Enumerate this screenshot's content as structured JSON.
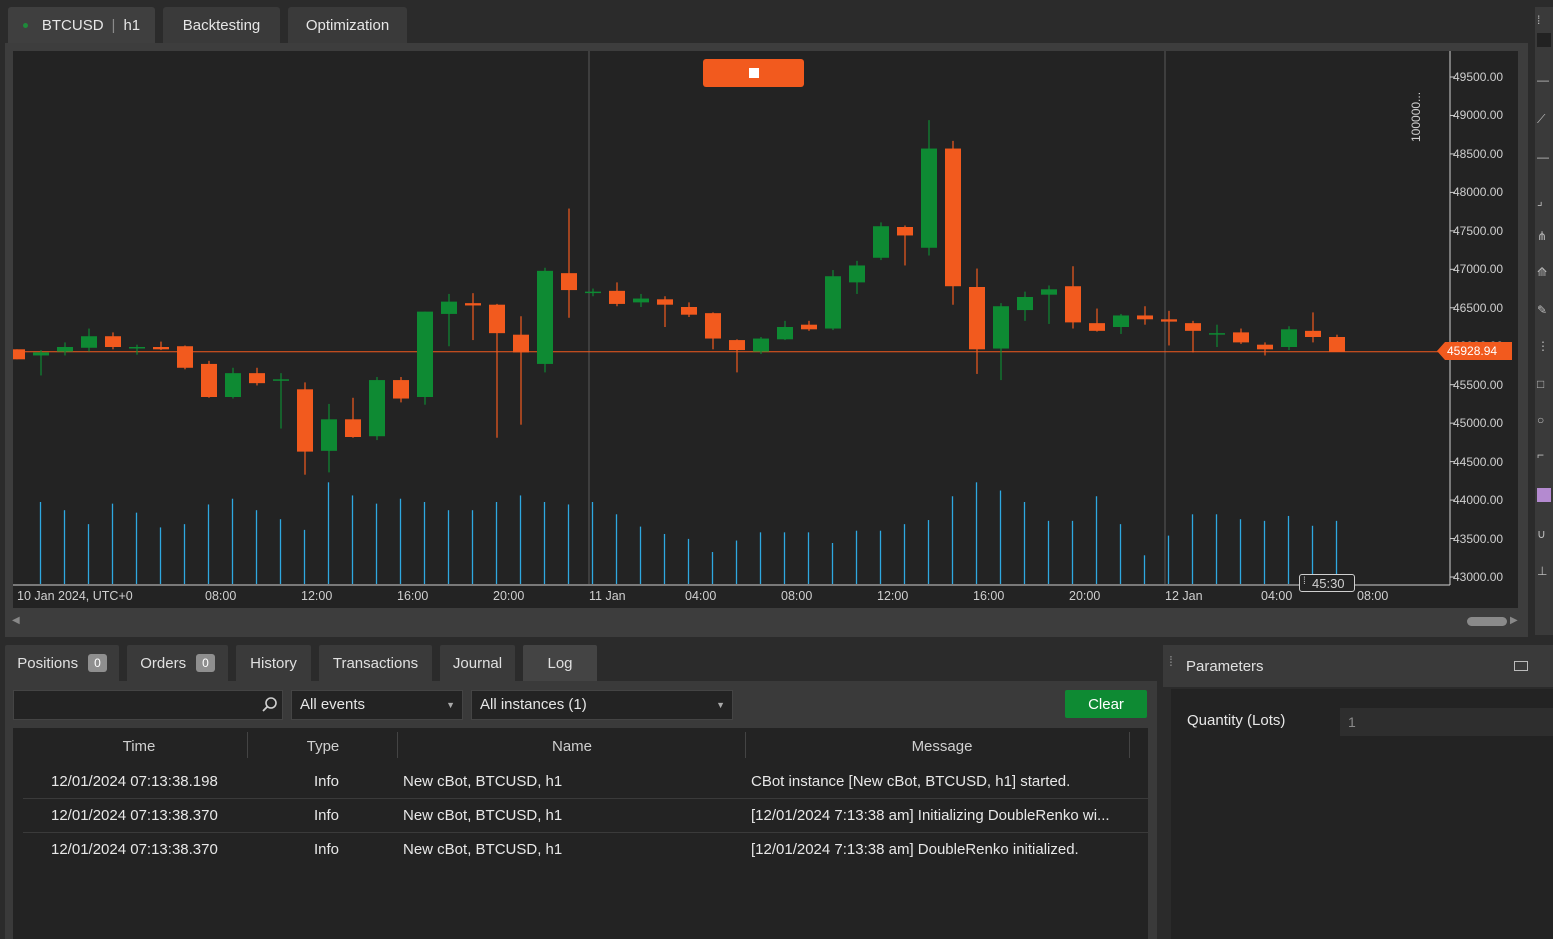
{
  "top_tabs": {
    "symbol": "BTCUSD",
    "timeframe": "h1",
    "backtesting": "Backtesting",
    "optimization": "Optimization"
  },
  "chart": {
    "price_axis": [
      "49500.00",
      "49000.00",
      "48500.00",
      "48000.00",
      "47500.00",
      "47000.00",
      "46500.00",
      "46000.00",
      "45500.00",
      "45000.00",
      "44500.00",
      "44000.00",
      "43500.00",
      "43000.00"
    ],
    "current_price": "45928.94",
    "time_axis": [
      "10 Jan 2024, UTC+0",
      "08:00",
      "12:00",
      "16:00",
      "20:00",
      "11 Jan",
      "04:00",
      "08:00",
      "12:00",
      "16:00",
      "20:00",
      "12 Jan",
      "04:00",
      "08:00"
    ],
    "countdown": "45:30",
    "volume_label": "100000...",
    "colors": {
      "bull": "#0e8a33",
      "bear": "#f25a1e",
      "volume": "#2ea8e0"
    }
  },
  "chart_data": {
    "type": "candlestick",
    "timeframe": "h1",
    "ylim": [
      43000,
      49600
    ],
    "candles": [
      {
        "o": 45960,
        "h": 45960,
        "l": 45830,
        "c": 45830
      },
      {
        "o": 45880,
        "h": 45950,
        "l": 45620,
        "c": 45920
      },
      {
        "o": 45930,
        "h": 46050,
        "l": 45880,
        "c": 45990
      },
      {
        "o": 45980,
        "h": 46230,
        "l": 45930,
        "c": 46130
      },
      {
        "o": 46130,
        "h": 46180,
        "l": 45960,
        "c": 45990
      },
      {
        "o": 45980,
        "h": 46020,
        "l": 45890,
        "c": 45990
      },
      {
        "o": 45990,
        "h": 46060,
        "l": 45950,
        "c": 45960
      },
      {
        "o": 46000,
        "h": 46010,
        "l": 45700,
        "c": 45720
      },
      {
        "o": 45770,
        "h": 45810,
        "l": 45330,
        "c": 45340
      },
      {
        "o": 45340,
        "h": 45720,
        "l": 45320,
        "c": 45650
      },
      {
        "o": 45650,
        "h": 45720,
        "l": 45490,
        "c": 45520
      },
      {
        "o": 45570,
        "h": 45650,
        "l": 44930,
        "c": 45570
      },
      {
        "o": 45440,
        "h": 45530,
        "l": 44330,
        "c": 44630
      },
      {
        "o": 44640,
        "h": 45250,
        "l": 44360,
        "c": 45050
      },
      {
        "o": 45050,
        "h": 45330,
        "l": 44810,
        "c": 44820
      },
      {
        "o": 44830,
        "h": 45600,
        "l": 44780,
        "c": 45560
      },
      {
        "o": 45560,
        "h": 45600,
        "l": 45270,
        "c": 45320
      },
      {
        "o": 45340,
        "h": 46450,
        "l": 45240,
        "c": 46450
      },
      {
        "o": 46420,
        "h": 46680,
        "l": 46000,
        "c": 46580
      },
      {
        "o": 46560,
        "h": 46690,
        "l": 46080,
        "c": 46530
      },
      {
        "o": 46540,
        "h": 46550,
        "l": 44810,
        "c": 46170
      },
      {
        "o": 46150,
        "h": 46390,
        "l": 44980,
        "c": 45920
      },
      {
        "o": 45770,
        "h": 47020,
        "l": 45660,
        "c": 46980
      },
      {
        "o": 46950,
        "h": 47790,
        "l": 46370,
        "c": 46730
      },
      {
        "o": 46700,
        "h": 46750,
        "l": 46650,
        "c": 46710
      },
      {
        "o": 46720,
        "h": 46830,
        "l": 46520,
        "c": 46550
      },
      {
        "o": 46570,
        "h": 46680,
        "l": 46510,
        "c": 46620
      },
      {
        "o": 46610,
        "h": 46650,
        "l": 46250,
        "c": 46540
      },
      {
        "o": 46510,
        "h": 46570,
        "l": 46380,
        "c": 46410
      },
      {
        "o": 46430,
        "h": 46440,
        "l": 45960,
        "c": 46100
      },
      {
        "o": 46080,
        "h": 46090,
        "l": 45660,
        "c": 45950
      },
      {
        "o": 45930,
        "h": 46120,
        "l": 45900,
        "c": 46100
      },
      {
        "o": 46090,
        "h": 46330,
        "l": 46080,
        "c": 46250
      },
      {
        "o": 46280,
        "h": 46330,
        "l": 46200,
        "c": 46220
      },
      {
        "o": 46230,
        "h": 46990,
        "l": 46210,
        "c": 46910
      },
      {
        "o": 46830,
        "h": 47110,
        "l": 46680,
        "c": 47050
      },
      {
        "o": 47150,
        "h": 47610,
        "l": 47120,
        "c": 47560
      },
      {
        "o": 47550,
        "h": 47570,
        "l": 47050,
        "c": 47440
      },
      {
        "o": 47280,
        "h": 48940,
        "l": 47180,
        "c": 48570
      },
      {
        "o": 48570,
        "h": 48670,
        "l": 46540,
        "c": 46780
      },
      {
        "o": 46770,
        "h": 47010,
        "l": 45640,
        "c": 45960
      },
      {
        "o": 45970,
        "h": 46560,
        "l": 45560,
        "c": 46520
      },
      {
        "o": 46470,
        "h": 46710,
        "l": 46330,
        "c": 46640
      },
      {
        "o": 46670,
        "h": 46790,
        "l": 46290,
        "c": 46740
      },
      {
        "o": 46780,
        "h": 47040,
        "l": 46230,
        "c": 46310
      },
      {
        "o": 46300,
        "h": 46490,
        "l": 46190,
        "c": 46200
      },
      {
        "o": 46250,
        "h": 46420,
        "l": 46160,
        "c": 46400
      },
      {
        "o": 46400,
        "h": 46520,
        "l": 46280,
        "c": 46350
      },
      {
        "o": 46350,
        "h": 46460,
        "l": 46010,
        "c": 46320
      },
      {
        "o": 46300,
        "h": 46330,
        "l": 45920,
        "c": 46200
      },
      {
        "o": 46170,
        "h": 46280,
        "l": 45990,
        "c": 46170
      },
      {
        "o": 46180,
        "h": 46230,
        "l": 46030,
        "c": 46050
      },
      {
        "o": 46020,
        "h": 46050,
        "l": 45880,
        "c": 45960
      },
      {
        "o": 45990,
        "h": 46260,
        "l": 45950,
        "c": 46220
      },
      {
        "o": 46200,
        "h": 46440,
        "l": 46050,
        "c": 46120
      },
      {
        "o": 46120,
        "h": 46150,
        "l": 45930,
        "c": 45930
      }
    ],
    "volume": [
      1.0,
      0.9,
      0.73,
      0.98,
      0.87,
      0.69,
      0.73,
      0.97,
      1.04,
      0.9,
      0.79,
      0.66,
      1.24,
      1.08,
      0.98,
      1.04,
      1.0,
      0.9,
      0.9,
      1.0,
      1.08,
      1.0,
      0.97,
      1.0,
      0.85,
      0.7,
      0.61,
      0.55,
      0.39,
      0.53,
      0.63,
      0.63,
      0.63,
      0.5,
      0.65,
      0.65,
      0.73,
      0.78,
      1.07,
      1.24,
      1.14,
      1.0,
      0.77,
      0.77,
      1.07,
      0.73,
      0.35,
      0.59,
      0.85,
      0.85,
      0.79,
      0.77,
      0.83,
      0.71,
      0.77
    ]
  },
  "bottom_tabs": {
    "positions": "Positions",
    "positions_count": "0",
    "orders": "Orders",
    "orders_count": "0",
    "history": "History",
    "transactions": "Transactions",
    "journal": "Journal",
    "log": "Log"
  },
  "log_toolbar": {
    "search_value": "",
    "events_filter": "All events",
    "instances_filter": "All instances (1)",
    "clear": "Clear"
  },
  "log_table": {
    "headers": {
      "time": "Time",
      "type": "Type",
      "name": "Name",
      "message": "Message"
    },
    "rows": [
      {
        "time": "12/01/2024 07:13:38.198",
        "type": "Info",
        "name": "New cBot, BTCUSD, h1",
        "message": "CBot instance [New cBot, BTCUSD, h1] started."
      },
      {
        "time": "12/01/2024 07:13:38.370",
        "type": "Info",
        "name": "New cBot, BTCUSD, h1",
        "message": "[12/01/2024 7:13:38 am] Initializing DoubleRenko wi..."
      },
      {
        "time": "12/01/2024 07:13:38.370",
        "type": "Info",
        "name": "New cBot, BTCUSD, h1",
        "message": "[12/01/2024 7:13:38 am] DoubleRenko initialized."
      }
    ]
  },
  "parameters": {
    "title": "Parameters",
    "quantity_label": "Quantity (Lots)",
    "quantity_value": "1"
  },
  "icons": [
    "search-icon",
    "stop-icon",
    "dropdown-arrow-icon",
    "panel-icon",
    "scroll-left-icon",
    "scroll-right-icon"
  ]
}
